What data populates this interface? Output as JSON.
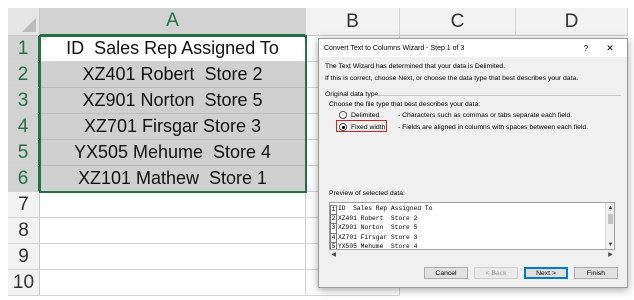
{
  "sheet": {
    "columns": [
      "A",
      "B",
      "C",
      "D"
    ],
    "rows": [
      "1",
      "2",
      "3",
      "4",
      "5",
      "6",
      "7",
      "8",
      "9",
      "10"
    ],
    "cells": [
      "ID  Sales Rep Assigned To",
      "XZ401 Robert  Store 2",
      "XZ901 Norton  Store 5",
      "XZ701 Firsgar Store 3",
      "YX505 Mehume  Store 4",
      "XZ101 Mathew  Store 1"
    ]
  },
  "dialog": {
    "title": "Convert Text to Columns Wizard - Step 1 of 3",
    "help_glyph": "?",
    "close_glyph": "✕",
    "intro1": "The Text Wizard has determined that your data is Delimited.",
    "intro2": "If this is correct, choose Next, or choose the data type that best describes your data.",
    "group_label": "Original data type",
    "choose_label": "Choose the file type that best describes your data:",
    "options": [
      {
        "label": "Delimited",
        "desc": "- Characters such as commas or tabs separate each field.",
        "selected": false
      },
      {
        "label": "Fixed width",
        "desc": "- Fields are aligned in columns with spaces between each field.",
        "selected": true
      }
    ],
    "preview_label": "Preview of selected data:",
    "preview_rows": [
      {
        "n": "1",
        "text": "ID  Sales Rep Assigned To"
      },
      {
        "n": "2",
        "text": "XZ401 Robert  Store 2"
      },
      {
        "n": "3",
        "text": "XZ901 Norton  Store 5"
      },
      {
        "n": "4",
        "text": "XZ701 Firsgar Store 3"
      },
      {
        "n": "5",
        "text": "YX505 Mehume  Store 4"
      }
    ],
    "buttons": {
      "cancel": "Cancel",
      "back": "< Back",
      "next": "Next >",
      "finish": "Finish"
    }
  },
  "colors": {
    "excel_green": "#217346",
    "selection_gray": "#d0d0d0",
    "highlight_red": "#e01c1c",
    "default_button_blue": "#0078d7"
  }
}
